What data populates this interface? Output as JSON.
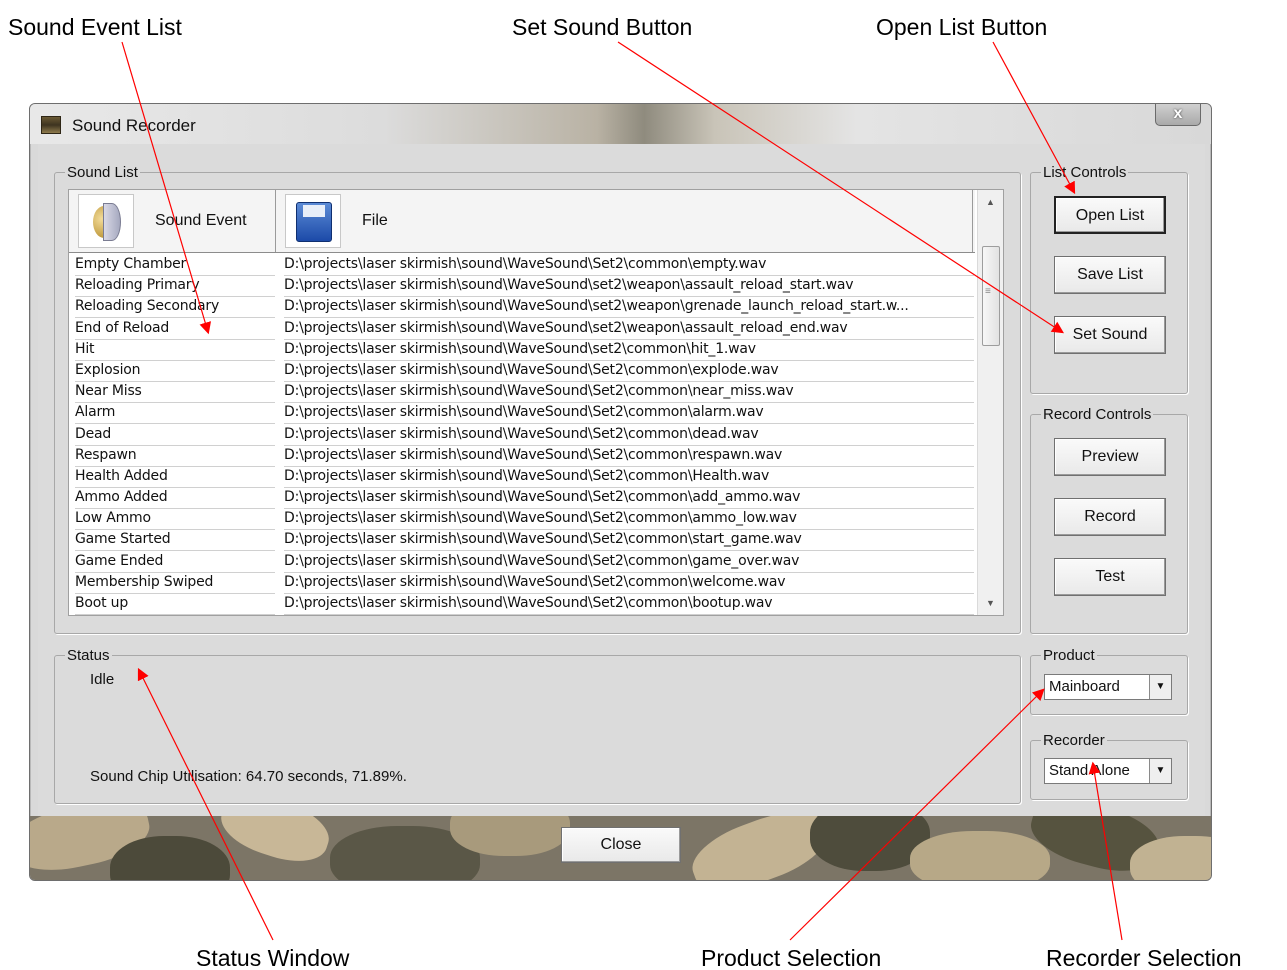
{
  "callouts": {
    "sound_event_list": "Sound Event List",
    "set_sound_button": "Set Sound Button",
    "open_list_button": "Open List Button",
    "status_window": "Status Window",
    "product_selection": "Product Selection",
    "recorder_selection": "Recorder Selection"
  },
  "window": {
    "title": "Sound Recorder",
    "close_glyph": "x"
  },
  "sound_list": {
    "legend": "Sound List",
    "headers": {
      "event": "Sound Event",
      "file": "File"
    },
    "rows": [
      {
        "event": "Empty Chamber",
        "file": "D:\\projects\\laser skirmish\\sound\\WaveSound\\Set2\\common\\empty.wav"
      },
      {
        "event": "Reloading Primary",
        "file": "D:\\projects\\laser skirmish\\sound\\WaveSound\\set2\\weapon\\assault_reload_start.wav"
      },
      {
        "event": "Reloading Secondary",
        "file": "D:\\projects\\laser skirmish\\sound\\WaveSound\\set2\\weapon\\grenade_launch_reload_start.w..."
      },
      {
        "event": "End of Reload",
        "file": "D:\\projects\\laser skirmish\\sound\\WaveSound\\set2\\weapon\\assault_reload_end.wav"
      },
      {
        "event": "Hit",
        "file": "D:\\projects\\laser skirmish\\sound\\WaveSound\\set2\\common\\hit_1.wav"
      },
      {
        "event": "Explosion",
        "file": "D:\\projects\\laser skirmish\\sound\\WaveSound\\Set2\\common\\explode.wav"
      },
      {
        "event": "Near Miss",
        "file": "D:\\projects\\laser skirmish\\sound\\WaveSound\\Set2\\common\\near_miss.wav"
      },
      {
        "event": "Alarm",
        "file": "D:\\projects\\laser skirmish\\sound\\WaveSound\\Set2\\common\\alarm.wav"
      },
      {
        "event": "Dead",
        "file": "D:\\projects\\laser skirmish\\sound\\WaveSound\\Set2\\common\\dead.wav"
      },
      {
        "event": "Respawn",
        "file": "D:\\projects\\laser skirmish\\sound\\WaveSound\\Set2\\common\\respawn.wav"
      },
      {
        "event": "Health Added",
        "file": "D:\\projects\\laser skirmish\\sound\\WaveSound\\Set2\\common\\Health.wav"
      },
      {
        "event": "Ammo Added",
        "file": "D:\\projects\\laser skirmish\\sound\\WaveSound\\Set2\\common\\add_ammo.wav"
      },
      {
        "event": "Low Ammo",
        "file": "D:\\projects\\laser skirmish\\sound\\WaveSound\\Set2\\common\\ammo_low.wav"
      },
      {
        "event": "Game Started",
        "file": "D:\\projects\\laser skirmish\\sound\\WaveSound\\Set2\\common\\start_game.wav"
      },
      {
        "event": "Game Ended",
        "file": "D:\\projects\\laser skirmish\\sound\\WaveSound\\Set2\\common\\game_over.wav"
      },
      {
        "event": "Membership Swiped",
        "file": "D:\\projects\\laser skirmish\\sound\\WaveSound\\Set2\\common\\welcome.wav"
      },
      {
        "event": "Boot up",
        "file": "D:\\projects\\laser skirmish\\sound\\WaveSound\\Set2\\common\\bootup.wav"
      }
    ]
  },
  "list_controls": {
    "legend": "List Controls",
    "open_list": "Open List",
    "save_list": "Save List",
    "set_sound": "Set Sound"
  },
  "record_controls": {
    "legend": "Record Controls",
    "preview": "Preview",
    "record": "Record",
    "test": "Test"
  },
  "status": {
    "legend": "Status",
    "state": "Idle",
    "utilisation": "Sound Chip Utilisation: 64.70 seconds, 71.89%."
  },
  "product": {
    "legend": "Product",
    "selected": "Mainboard"
  },
  "recorder": {
    "legend": "Recorder",
    "selected": "Stand Alone"
  },
  "footer": {
    "close": "Close"
  },
  "colors": {
    "annotation_arrow": "#ff0000",
    "window_bg": "#dbdbdb"
  }
}
